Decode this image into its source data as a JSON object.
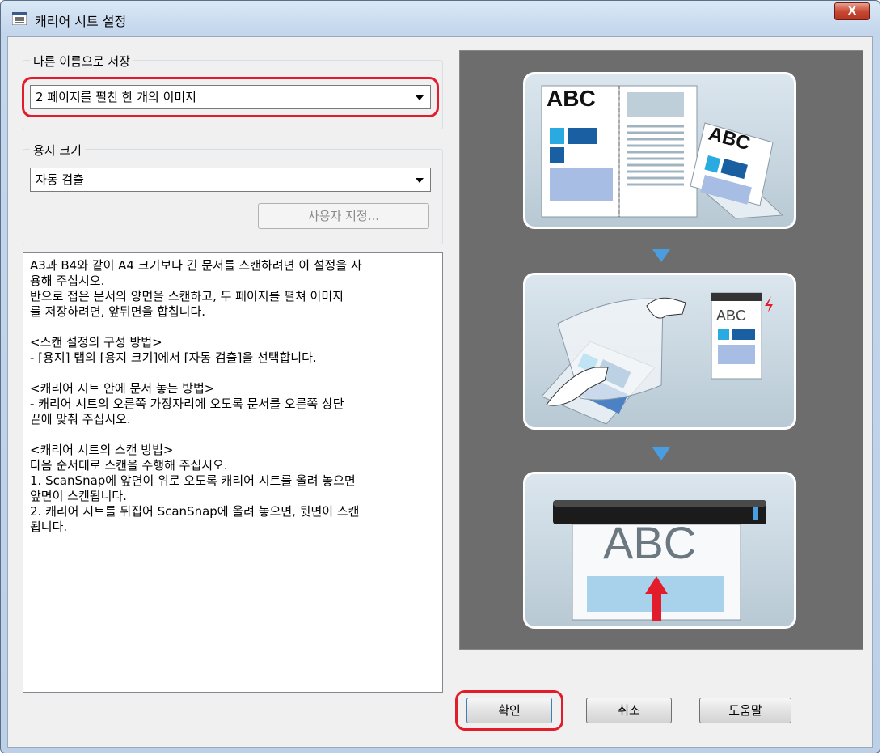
{
  "window": {
    "title": "캐리어 시트 설정",
    "close_label": "X"
  },
  "save_as": {
    "group_label": "다른 이름으로 저장",
    "selected": "2 페이지를 펼친 한 개의 이미지"
  },
  "paper_size": {
    "group_label": "용지 크기",
    "selected": "자동 검출",
    "custom_button": "사용자 지정..."
  },
  "description": "A3과 B4와 같이 A4 크기보다 긴 문서를 스캔하려면 이 설정을 사\n용해 주십시오.\n반으로 접은 문서의 양면을 스캔하고, 두 페이지를 펼쳐 이미지\n를 저장하려면, 앞뒤면을 합칩니다.\n\n<스캔 설정의 구성 방법>\n- [용지] 탭의 [용지 크기]에서 [자동 검출]을 선택합니다.\n\n<캐리어 시트 안에 문서 놓는 방법>\n- 캐리어 시트의 오른쪽 가장자리에 오도록 문서를 오른쪽 상단\n끝에 맞춰 주십시오.\n\n<캐리어 시트의 스캔 방법>\n다음 순서대로 스캔을 수행해 주십시오.\n1. ScanSnap에 앞면이 위로 오도록 캐리어 시트를 올려 놓으면\n앞면이 스캔됩니다.\n2. 캐리어 시트를 뒤집어 ScanSnap에 올려 놓으면, 뒷면이 스캔\n됩니다.",
  "preview": {
    "text_abc": "ABC"
  },
  "buttons": {
    "ok": "확인",
    "cancel": "취소",
    "help": "도움말"
  },
  "colors": {
    "highlight": "#e31c2b",
    "preview_bg": "#6d6d6d",
    "arrow_blue": "#4a9ee0"
  }
}
